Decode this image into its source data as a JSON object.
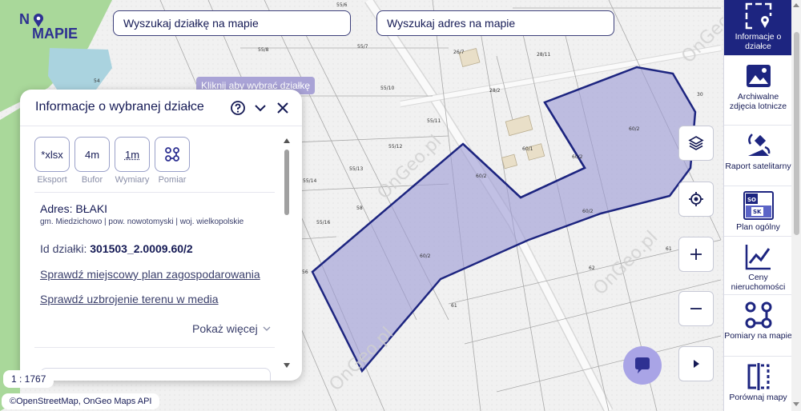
{
  "logo": {
    "text_no": "N",
    "text_mapie": "MAPIE",
    "accent": "#2e3192"
  },
  "search": {
    "parcel_placeholder": "Wyszukaj działkę na mapie",
    "address_placeholder": "Wyszukaj adres na mapie"
  },
  "map": {
    "hint": "Kliknij aby wybrać działkę",
    "parcel_fill": "#9b99d6",
    "parcel_stroke": "#1d2580",
    "watermark": "OnGeo.pl",
    "parcel_labels": [
      "55/6",
      "55/7",
      "55/8",
      "55/10",
      "55/11",
      "55/12",
      "55/13",
      "55/14",
      "55/16",
      "26/7",
      "28/11",
      "28/2",
      "30",
      "60/2",
      "60/2",
      "60/2",
      "60/2",
      "60/1",
      "62",
      "61",
      "56",
      "54",
      "58"
    ],
    "scale": "1 : 1767",
    "attribution": "©OpenStreetMap, OnGeo Maps API"
  },
  "panel": {
    "title": "Informacje o wybranej działce",
    "tools": [
      {
        "value": "*xlsx",
        "label": "Eksport"
      },
      {
        "value": "4m",
        "label": "Bufor"
      },
      {
        "value": "1m",
        "label": "Wymiary"
      },
      {
        "value": "",
        "label": "Pomiar",
        "icon": "route-icon"
      }
    ],
    "address_label": "Adres: BŁAKI",
    "address_sub": "gm. Miedzichowo | pow. nowotomyski | woj. wielkopolskie",
    "parcel_id_label": "Id działki: ",
    "parcel_id_value": "301503_2.0009.60/2",
    "link_plan": "Sprawdź miejscowy plan zagospodarowania",
    "link_media": "Sprawdź uzbrojenie terenu w media",
    "show_more": "Pokaż więcej"
  },
  "controls": [
    "layers-icon",
    "locate-icon",
    "zoom-in-icon",
    "zoom-out-icon",
    "play-icon"
  ],
  "sidebar": {
    "items": [
      {
        "label": "Informacje o działce",
        "icon": "parcel-info-icon",
        "active": true
      },
      {
        "label": "Archiwalne zdjęcia lotnicze",
        "icon": "aerial-photo-icon",
        "active": false
      },
      {
        "label": "Raport satelitarny",
        "icon": "satellite-icon",
        "active": false
      },
      {
        "label": "Plan ogólny",
        "icon": "plan-icon",
        "active": false
      },
      {
        "label": "Ceny nieruchomości",
        "icon": "price-chart-icon",
        "active": false
      },
      {
        "label": "Pomiary na mapie",
        "icon": "measure-icon",
        "active": false
      },
      {
        "label": "Porównaj mapy",
        "icon": "compare-icon",
        "active": false
      }
    ]
  }
}
